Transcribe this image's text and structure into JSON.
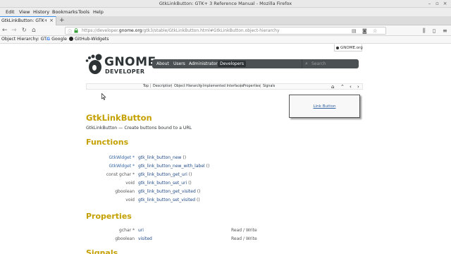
{
  "window": {
    "title": "GtkLinkButton: GTK+ 3 Reference Manual - Mozilla Firefox"
  },
  "menu": [
    "Edit",
    "View",
    "History",
    "Bookmarks",
    "Tools",
    "Help"
  ],
  "tab": {
    "label": "GtkLinkButton: GTK+ 3 Re",
    "close": "×",
    "new_tab": "+"
  },
  "url": {
    "prefix": "https://developer.",
    "domain": "gnome.org",
    "path": "/gtk3/stable/GtkLinkButton.html#GtkLinkButton.object-hierarchy"
  },
  "bookmarks": [
    {
      "label": "Object Hierarchy: GT..."
    },
    {
      "label": "Google"
    },
    {
      "label": "GitHub-Widgets"
    }
  ],
  "site": {
    "badge": "GNOME.org",
    "logo": "GNOME",
    "logo_sub": "DEVELOPER",
    "nav": [
      "About",
      "Users",
      "Administrators",
      "Developers"
    ],
    "search_placeholder": "Search"
  },
  "toc": [
    "Top",
    "Description",
    "Object Hierarchy",
    "Implemented Interfaces",
    "Properties",
    "Signals"
  ],
  "tooltip": {
    "link": "Link Button"
  },
  "content": {
    "title": "GtkLinkButton",
    "description": "GtkLinkButton — Create buttons bound to a URL",
    "functions_heading": "Functions",
    "functions": [
      {
        "ret": "GtkWidget *",
        "ret_link": true,
        "name": "gtk_link_button_new"
      },
      {
        "ret": "GtkWidget *",
        "ret_link": true,
        "name": "gtk_link_button_new_with_label"
      },
      {
        "ret": "const gchar *",
        "ret_link": false,
        "name": "gtk_link_button_get_uri"
      },
      {
        "ret": "void",
        "ret_link": false,
        "name": "gtk_link_button_set_uri"
      },
      {
        "ret": "gboolean",
        "ret_link": false,
        "name": "gtk_link_button_get_visited"
      },
      {
        "ret": "void",
        "ret_link": false,
        "name": "gtk_link_button_set_visited"
      }
    ],
    "fn_parens": "()",
    "properties_heading": "Properties",
    "properties": [
      {
        "type": "gchar *",
        "name": "uri",
        "access": "Read / Write"
      },
      {
        "type": "gboolean",
        "name": "visited",
        "access": "Read / Write"
      }
    ],
    "signals_heading": "Signals"
  },
  "colors": {
    "heading": "#c4a000",
    "link": "#3465a4",
    "nav_bg": "#4b5052"
  }
}
